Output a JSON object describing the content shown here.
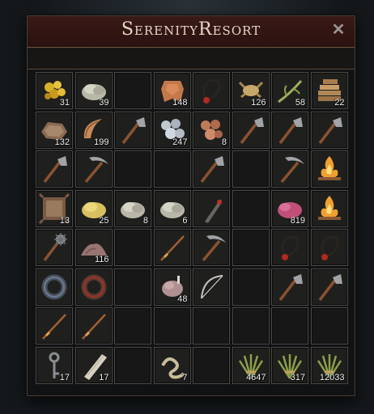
{
  "window": {
    "title": "SerenityResort"
  },
  "icons": {
    "close": "close-icon"
  },
  "slots": [
    {
      "item": "gold-nuggets",
      "qty": "31"
    },
    {
      "item": "stone-pile",
      "qty": "39"
    },
    null,
    {
      "item": "leather-hide",
      "qty": "148"
    },
    {
      "item": "rope-coil",
      "qty": ""
    },
    {
      "item": "crab-meat",
      "qty": "126"
    },
    {
      "item": "fiber-twig",
      "qty": "58"
    },
    {
      "item": "wood-pile",
      "qty": "22"
    },
    {
      "item": "fur-pelt",
      "qty": "132"
    },
    {
      "item": "horn",
      "qty": "199"
    },
    {
      "item": "hatchet",
      "qty": ""
    },
    {
      "item": "silver-ore",
      "qty": "247"
    },
    {
      "item": "copper-ore",
      "qty": "8"
    },
    {
      "item": "hatchet",
      "qty": ""
    },
    {
      "item": "hatchet",
      "qty": ""
    },
    {
      "item": "hatchet",
      "qty": ""
    },
    {
      "item": "hatchet",
      "qty": ""
    },
    {
      "item": "pickaxe",
      "qty": ""
    },
    null,
    null,
    {
      "item": "hatchet",
      "qty": ""
    },
    null,
    {
      "item": "pickaxe",
      "qty": ""
    },
    {
      "item": "campfire",
      "qty": ""
    },
    {
      "item": "fur-pelt-square",
      "qty": "13"
    },
    {
      "item": "sulfur-lump",
      "qty": "25"
    },
    {
      "item": "stone-pile",
      "qty": "8"
    },
    {
      "item": "stone-pile",
      "qty": "6"
    },
    {
      "item": "fish",
      "qty": ""
    },
    null,
    {
      "item": "raw-meat",
      "qty": "819"
    },
    {
      "item": "campfire",
      "qty": ""
    },
    {
      "item": "spiked-mace",
      "qty": ""
    },
    {
      "item": "dirt-pile",
      "qty": "116"
    },
    null,
    {
      "item": "fishing-rod",
      "qty": ""
    },
    {
      "item": "pickaxe",
      "qty": ""
    },
    null,
    {
      "item": "rope-coil",
      "qty": ""
    },
    {
      "item": "rope-coil",
      "qty": ""
    },
    {
      "item": "iron-ring",
      "qty": ""
    },
    {
      "item": "bronze-ring",
      "qty": ""
    },
    null,
    {
      "item": "cooked-meat",
      "qty": "48"
    },
    {
      "item": "bow",
      "qty": ""
    },
    null,
    {
      "item": "hatchet",
      "qty": ""
    },
    {
      "item": "hatchet",
      "qty": ""
    },
    {
      "item": "fishing-rod",
      "qty": ""
    },
    {
      "item": "fishing-rod",
      "qty": ""
    },
    null,
    null,
    null,
    null,
    null,
    null,
    {
      "item": "iron-key",
      "qty": "17"
    },
    {
      "item": "bandage",
      "qty": "17"
    },
    null,
    {
      "item": "worm",
      "qty": "7"
    },
    null,
    {
      "item": "grass-bundle",
      "qty": "4647"
    },
    {
      "item": "grass-bundle",
      "qty": "317"
    },
    {
      "item": "grass-bundle",
      "qty": "12033"
    }
  ]
}
